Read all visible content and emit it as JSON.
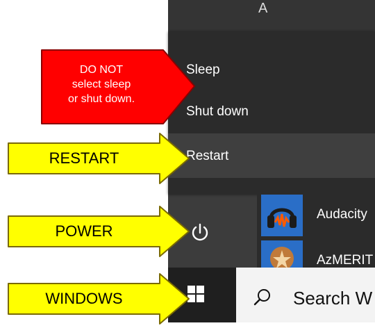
{
  "start_menu": {
    "top_letter": "A",
    "power_options": {
      "sleep": "Sleep",
      "shutdown": "Shut down",
      "restart": "Restart"
    },
    "apps": [
      {
        "name": "Audacity",
        "icon": "audacity-icon"
      },
      {
        "name": "AzMERIT",
        "icon": "azmerit-icon"
      }
    ],
    "power_button_icon": "power-icon"
  },
  "taskbar": {
    "windows_icon": "windows-logo-icon",
    "search_icon": "search-icon",
    "search_text": "Search W"
  },
  "callouts": {
    "warning_lines": [
      "DO NOT",
      "select sleep",
      "or shut down."
    ],
    "restart": "RESTART",
    "power": "POWER",
    "windows": "WINDOWS"
  },
  "colors": {
    "warning_fill": "#ff0000",
    "arrow_fill": "#ffff00",
    "menu_bg": "#2b2b2b",
    "highlight_bg": "#3f3f3f",
    "taskbar_bg": "#1f1f1f",
    "app_tile": "#2a6ec7"
  }
}
